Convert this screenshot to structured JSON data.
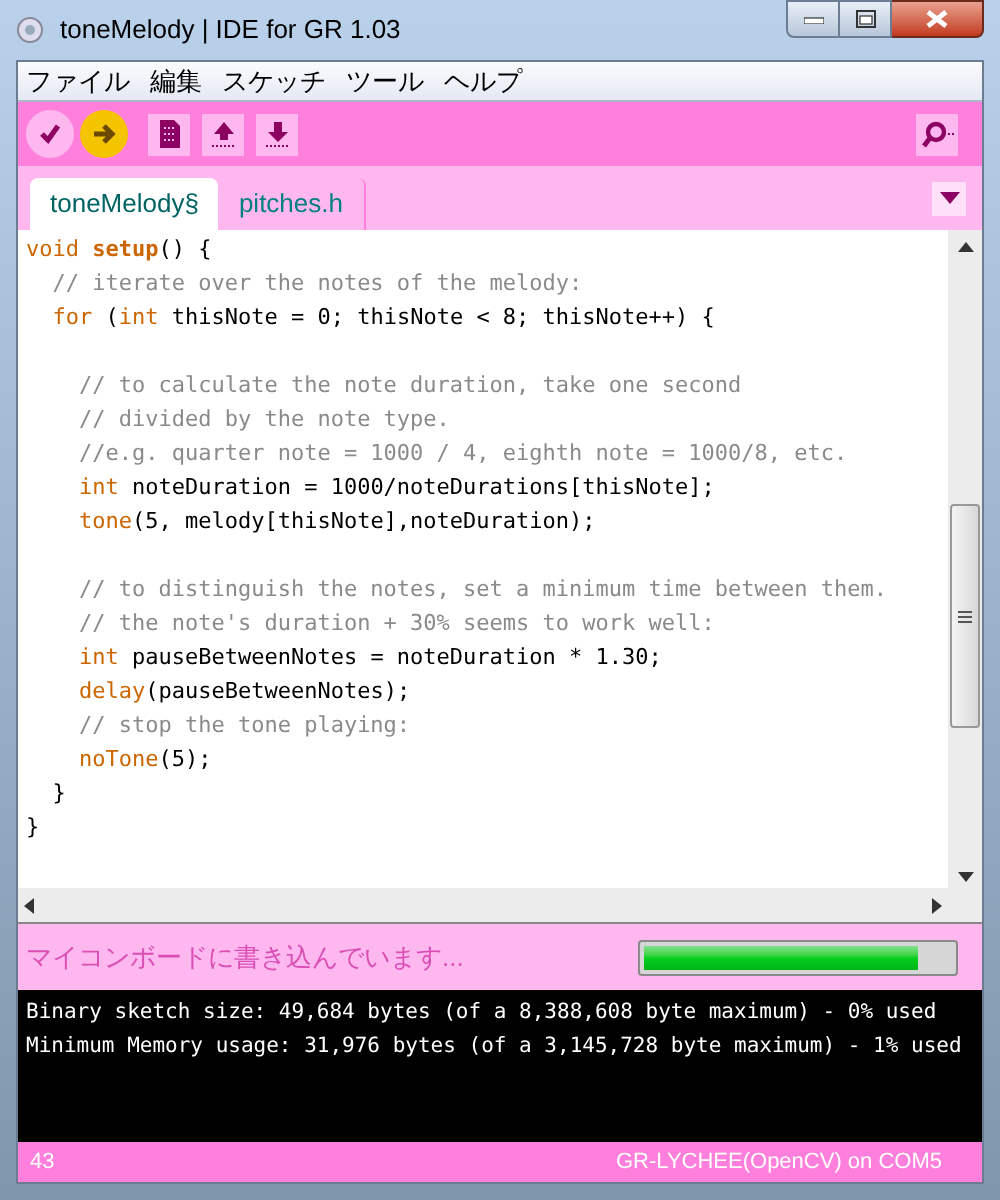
{
  "window": {
    "title": "toneMelody | IDE for GR 1.03"
  },
  "menu": [
    "ファイル",
    "編集",
    "スケッチ",
    "ツール",
    "ヘルプ"
  ],
  "toolbar": [
    {
      "kind": "verify"
    },
    {
      "kind": "upload"
    },
    {
      "kind": "new"
    },
    {
      "kind": "open"
    },
    {
      "kind": "save"
    }
  ],
  "tabs": [
    {
      "label": "toneMelody§",
      "selected": true
    },
    {
      "label": "pitches.h",
      "selected": false
    }
  ],
  "code": [
    {
      "kind": "code",
      "segments": [
        {
          "text": "void ",
          "kind": "type"
        },
        {
          "text": "setup",
          "kind": "bold"
        },
        {
          "text": "() {",
          "kind": "plain"
        }
      ]
    },
    {
      "kind": "code",
      "segments": [
        {
          "text": "  // iterate over the notes of the melody:",
          "kind": "comment"
        }
      ]
    },
    {
      "kind": "code",
      "segments": [
        {
          "text": "  for",
          "kind": "type"
        },
        {
          "text": " (",
          "kind": "plain"
        },
        {
          "text": "int",
          "kind": "type"
        },
        {
          "text": " thisNote = 0; thisNote < 8; thisNote++) {",
          "kind": "plain"
        }
      ]
    },
    {
      "kind": "blank"
    },
    {
      "kind": "code",
      "segments": [
        {
          "text": "    // to calculate the note duration, take one second",
          "kind": "comment"
        }
      ]
    },
    {
      "kind": "code",
      "segments": [
        {
          "text": "    // divided by the note type.",
          "kind": "comment"
        }
      ]
    },
    {
      "kind": "code",
      "segments": [
        {
          "text": "    //e.g. quarter note = 1000 / 4, eighth note = 1000/8, etc.",
          "kind": "comment"
        }
      ]
    },
    {
      "kind": "code",
      "segments": [
        {
          "text": "    int",
          "kind": "type"
        },
        {
          "text": " noteDuration = 1000/noteDurations[thisNote];",
          "kind": "plain"
        }
      ]
    },
    {
      "kind": "code",
      "segments": [
        {
          "text": "    tone",
          "kind": "type"
        },
        {
          "text": "(5, melody[thisNote],noteDuration);",
          "kind": "plain"
        }
      ]
    },
    {
      "kind": "blank"
    },
    {
      "kind": "code",
      "segments": [
        {
          "text": "    // to distinguish the notes, set a minimum time between them.",
          "kind": "comment"
        }
      ]
    },
    {
      "kind": "code",
      "segments": [
        {
          "text": "    // the note's duration + 30% seems to work well:",
          "kind": "comment"
        }
      ]
    },
    {
      "kind": "code",
      "segments": [
        {
          "text": "    int",
          "kind": "type"
        },
        {
          "text": " pauseBetweenNotes = noteDuration * 1.30;",
          "kind": "plain"
        }
      ]
    },
    {
      "kind": "code",
      "segments": [
        {
          "text": "    delay",
          "kind": "type"
        },
        {
          "text": "(pauseBetweenNotes);",
          "kind": "plain"
        }
      ]
    },
    {
      "kind": "code",
      "segments": [
        {
          "text": "    // stop the tone playing:",
          "kind": "comment"
        }
      ]
    },
    {
      "kind": "code",
      "segments": [
        {
          "text": "    noTone",
          "kind": "type"
        },
        {
          "text": "(5);",
          "kind": "plain"
        }
      ]
    },
    {
      "kind": "code",
      "segments": [
        {
          "text": "  }",
          "kind": "plain"
        }
      ]
    },
    {
      "kind": "code",
      "segments": [
        {
          "text": "}",
          "kind": "plain"
        }
      ]
    }
  ],
  "status": {
    "message": "マイコンボードに書き込んでいます...",
    "level": 0.89
  },
  "console": [
    "Binary sketch size: 49,684 bytes (of a 8,388,608 byte maximum) - 0% used",
    "Minimum Memory usage: 31,976 bytes (of a 3,145,728 byte maximum) - 1% used"
  ],
  "status_bar": {
    "line": "43",
    "board": "GR-LYCHEE(OpenCV) on COM5"
  }
}
